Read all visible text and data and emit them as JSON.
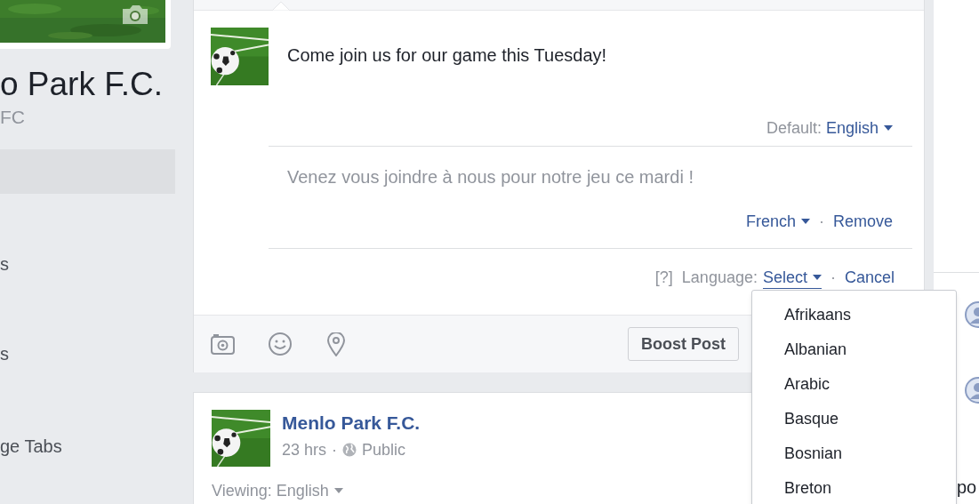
{
  "sidebar": {
    "page_name": "o Park F.C.",
    "username": "FC",
    "active_row": true,
    "items": [
      {
        "label": "s"
      },
      {
        "label": "s"
      },
      {
        "label": "ge Tabs"
      }
    ]
  },
  "composer": {
    "text": "Come join us for our game this Tuesday!",
    "default_label": "Default:",
    "default_language": "English",
    "translation": {
      "text": "Venez vous joindre à nous pour notre jeu ce mardi !",
      "language": "French",
      "separator": "·",
      "remove": "Remove"
    },
    "language_row": {
      "help": "[?]",
      "label": "Language:",
      "select": "Select",
      "separator": "·",
      "cancel": "Cancel"
    },
    "boost_button": "Boost Post"
  },
  "language_menu": {
    "items": [
      "Afrikaans",
      "Albanian",
      "Arabic",
      "Basque",
      "Bosnian",
      "Breton"
    ]
  },
  "post": {
    "author": "Menlo Park F.C.",
    "time": "23 hrs",
    "separator": "·",
    "audience": "Public",
    "viewing": "Viewing: English"
  },
  "right_column": {
    "text": "po"
  }
}
